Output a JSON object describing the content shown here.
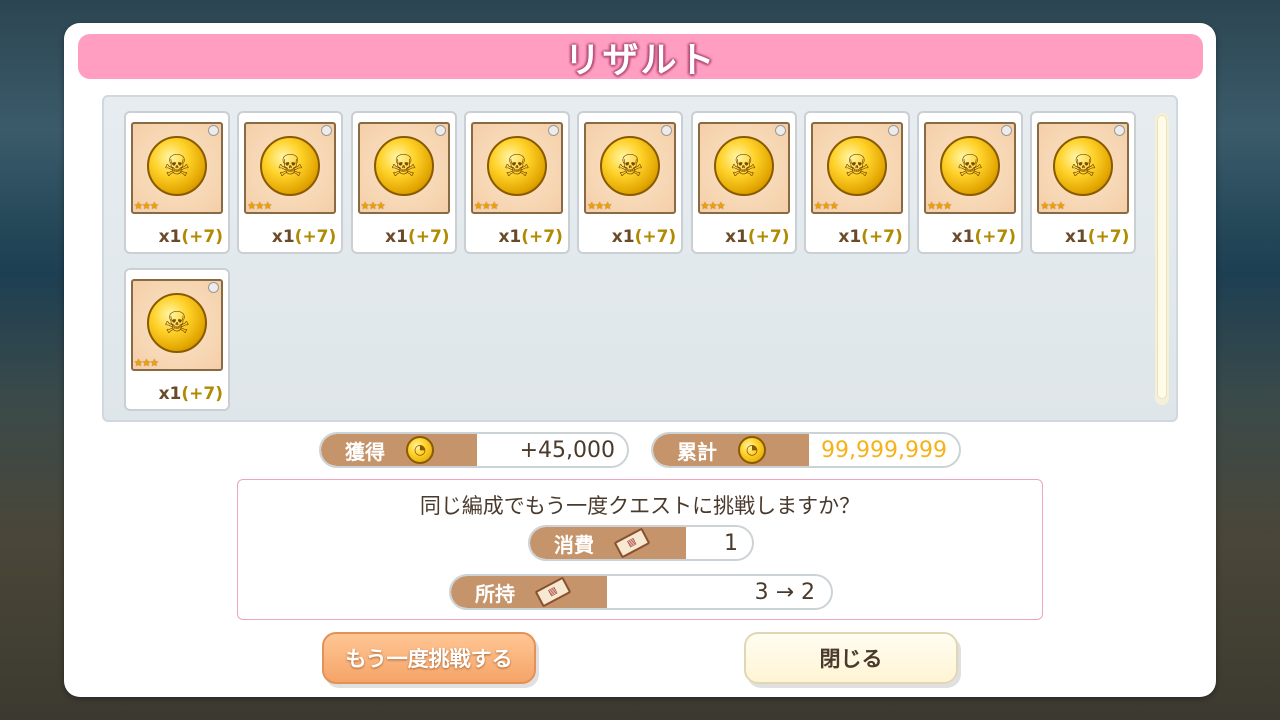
{
  "title": "リザルト",
  "rewards": [
    {
      "count": "x1",
      "bonus": "(+7)"
    },
    {
      "count": "x1",
      "bonus": "(+7)"
    },
    {
      "count": "x1",
      "bonus": "(+7)"
    },
    {
      "count": "x1",
      "bonus": "(+7)"
    },
    {
      "count": "x1",
      "bonus": "(+7)"
    },
    {
      "count": "x1",
      "bonus": "(+7)"
    },
    {
      "count": "x1",
      "bonus": "(+7)"
    },
    {
      "count": "x1",
      "bonus": "(+7)"
    },
    {
      "count": "x1",
      "bonus": "(+7)"
    },
    {
      "count": "x1",
      "bonus": "(+7)"
    }
  ],
  "reward_rarity_stars": 3,
  "summary": {
    "gained_label": "獲得",
    "gained_value": "+45,000",
    "total_label": "累計",
    "total_value": "99,999,999",
    "total_color": "#f5b21a"
  },
  "retry": {
    "question": "同じ編成でもう一度クエストに挑戦しますか？",
    "cost_label": "消費",
    "cost_value": "1",
    "owned_label": "所持",
    "owned_value": "3 → 2"
  },
  "buttons": {
    "retry": "もう一度挑戦する",
    "close": "閉じる"
  },
  "colors": {
    "title_bar": "#ff9ec0",
    "label_bg": "#c6946a",
    "retry_button": "#f5a468"
  },
  "icons": {
    "reward": "gold-skull-coin-icon",
    "currency": "coin-icon",
    "ticket": "ticket-icon"
  }
}
